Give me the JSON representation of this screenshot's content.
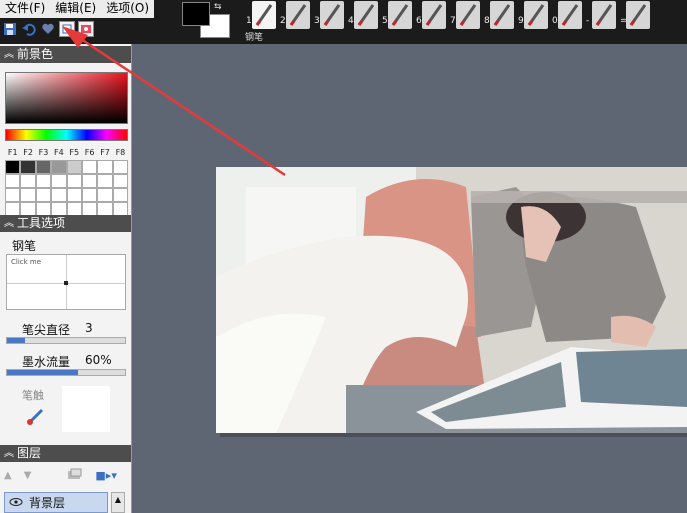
{
  "menu": {
    "items": [
      "文件(F)",
      "编辑(E)",
      "选项(O)"
    ]
  },
  "brushes": {
    "items": [
      {
        "num": "1",
        "label": "钢笔",
        "icon": "pen-icon",
        "active": true
      },
      {
        "num": "2",
        "label": "",
        "icon": "pencil-icon"
      },
      {
        "num": "3",
        "label": "",
        "icon": "crayon-icon"
      },
      {
        "num": "4",
        "label": "",
        "icon": "marker-icon"
      },
      {
        "num": "5",
        "label": "",
        "icon": "airbrush-icon"
      },
      {
        "num": "6",
        "label": "",
        "icon": "spray-icon"
      },
      {
        "num": "7",
        "label": "",
        "icon": "paintbrush-icon"
      },
      {
        "num": "8",
        "label": "",
        "icon": "flat-brush-icon"
      },
      {
        "num": "9",
        "label": "",
        "icon": "blur-icon"
      },
      {
        "num": "0",
        "label": "",
        "icon": "water-drop-icon"
      },
      {
        "num": "-",
        "label": "",
        "icon": "finger-smudge-icon"
      },
      {
        "num": "=",
        "label": "",
        "icon": "eraser-icon"
      }
    ]
  },
  "colors": {
    "fg": "#000000",
    "bg": "#ffffff",
    "accent": "#4a78c2"
  },
  "panel": {
    "foreground_title": "前景色",
    "fkeys": [
      "F1",
      "F2",
      "F3",
      "F4",
      "F5",
      "F6",
      "F7",
      "F8"
    ],
    "swatches_row1": [
      "#000000",
      "#333333",
      "#666666",
      "#999999",
      "#cccccc",
      "#ffffff",
      "#ffffff",
      "#ffffff"
    ],
    "tool_options_title": "工具选项",
    "tool_name": "钢笔",
    "preview_hint": "Click me",
    "tip_label": "笔尖直径",
    "tip_value": "3",
    "tip_fraction": 0.15,
    "flow_label": "墨水流量",
    "flow_value": "60%",
    "flow_fraction": 0.6,
    "texture_label": "笔触",
    "layers_title": "图层",
    "layer_name": "背景层"
  }
}
